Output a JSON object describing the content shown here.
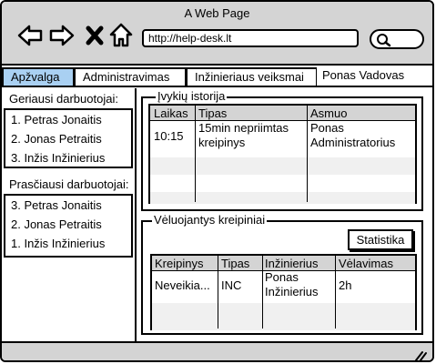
{
  "window": {
    "title": "A Web Page"
  },
  "browser": {
    "url": "http://help-desk.lt"
  },
  "tabs": [
    {
      "label": "Apžvalga"
    },
    {
      "label": "Administravimas"
    },
    {
      "label": "Inžinieriaus veiksmai"
    },
    {
      "label": "Ponas Vadovas"
    }
  ],
  "sidebar": {
    "best_heading": "Geriausi darbuotojai:",
    "best": [
      "1. Petras Jonaitis",
      "2. Jonas Petraitis",
      "3. Inžis Inžinierius"
    ],
    "worst_heading": "Prasčiausi darbuotojai:",
    "worst": [
      "3. Petras Jonaitis",
      "2. Jonas Petraitis",
      "1. Inžis Inžinierius"
    ]
  },
  "history": {
    "legend": "Įvykių istorija",
    "columns": [
      "Laikas",
      "Tipas",
      "Asmuo"
    ],
    "rows": [
      {
        "time": "10:15",
        "type_line1": "15min nepriimtas",
        "type_line2": "kreipinys",
        "person_line1": "Ponas",
        "person_line2": "Administratorius"
      }
    ]
  },
  "late": {
    "legend": "Vėluojantys kreipiniai",
    "button": "Statistika",
    "columns": [
      "Kreipinys",
      "Tipas",
      "Inžinierius",
      "Vėlavimas"
    ],
    "rows": [
      {
        "request": "Neveikia...",
        "type": "INC",
        "eng_line1": "Ponas",
        "eng_line2": "Inžinierius",
        "delay": "2h"
      }
    ]
  }
}
